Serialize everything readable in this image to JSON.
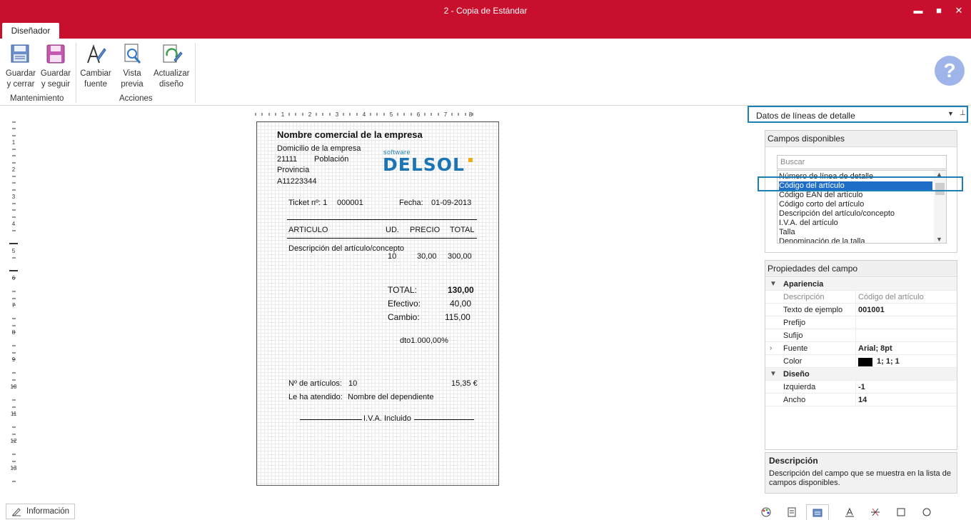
{
  "window": {
    "title": "2 - Copia de Estándar",
    "controls": {
      "minimize": "▬",
      "maximize": "■",
      "close": "✕"
    }
  },
  "ribbon": {
    "tab": "Diseñador",
    "buttons": {
      "guardar_cerrar": [
        "Guardar",
        "y cerrar"
      ],
      "guardar_seguir": [
        "Guardar",
        "y seguir"
      ],
      "cambiar_fuente": [
        "Cambiar",
        "fuente"
      ],
      "vista_previa": [
        "Vista",
        "previa"
      ],
      "actualizar": [
        "Actualizar",
        "diseño"
      ]
    },
    "groups": {
      "mantenimiento": "Mantenimiento",
      "acciones": "Acciones"
    },
    "help": "?"
  },
  "ruler": {
    "h": [
      "1",
      "2",
      "3",
      "4",
      "5",
      "6",
      "7",
      "8"
    ],
    "v": [
      "1",
      "2",
      "3",
      "4",
      "5",
      "6",
      "7",
      "8",
      "9",
      "10",
      "11",
      "12",
      "13"
    ]
  },
  "ticket": {
    "company": "Nombre  comercial de la empresa",
    "address": "Domicilio de la empresa",
    "postal": "21111",
    "city": "Población",
    "province": "Provincia",
    "cif": "A11223344",
    "logo_small": "software",
    "logo": "DELSOL",
    "ticket_label": "Ticket nº:  1",
    "ticket_no": "000001",
    "date_label": "Fecha:",
    "date": "01-09-2013",
    "col_articulo": "ARTICULO",
    "col_ud": "UD.",
    "col_precio": "PRECIO",
    "col_total": "TOTAL",
    "line_desc": "Descripción del artículo/concepto",
    "line_ud": "10",
    "line_precio": "30,00",
    "line_total": "300,00",
    "total_label": "TOTAL:",
    "total": "130,00",
    "efectivo_label": "Efectivo:",
    "efectivo": "40,00",
    "cambio_label": "Cambio:",
    "cambio": "115,00",
    "dto": "dto1.000,00%",
    "num_articulos_label": "Nº de artículos:",
    "num_articulos": "10",
    "amount": "15,35 €",
    "attended_label": "Le ha atendido:",
    "attended": "Nombre del dependiente",
    "iva": "I.V.A. Incluido"
  },
  "dock": {
    "selector": "Datos de líneas de detalle",
    "pin": "⊥"
  },
  "fields": {
    "title": "Campos disponibles",
    "search_placeholder": "Buscar",
    "items": [
      "Número de línea de detalle",
      "Código del artículo",
      "Código EAN del artículo",
      "Código corto del artículo",
      "Descripción del artículo/concepto",
      "I.V.A. del artículo",
      "Talla",
      "Denominación de la talla"
    ],
    "selected_index": 1
  },
  "properties": {
    "title": "Propiedades del campo",
    "apariencia": "Apariencia",
    "descripcion_k": "Descripción",
    "descripcion_v": "Código del artículo",
    "texto_k": "Texto de ejemplo",
    "texto_v": "001001",
    "prefijo_k": "Prefijo",
    "sufijo_k": "Sufijo",
    "fuente_k": "Fuente",
    "fuente_v": "Arial; 8pt",
    "color_k": "Color",
    "color_v": "1; 1; 1",
    "color_hex": "#000000",
    "diseno": "Diseño",
    "izquierda_k": "Izquierda",
    "izquierda_v": "-1",
    "ancho_k": "Ancho",
    "ancho_v": "14"
  },
  "description": {
    "title": "Descripción",
    "text": "Descripción del campo que se muestra en la lista de campos disponibles."
  },
  "bottom": {
    "info": "Información"
  },
  "colors": {
    "brand": "#c8102e",
    "highlight": "#1c7fb6",
    "selection": "#1e6ec8",
    "logo": "#1a74b5"
  }
}
